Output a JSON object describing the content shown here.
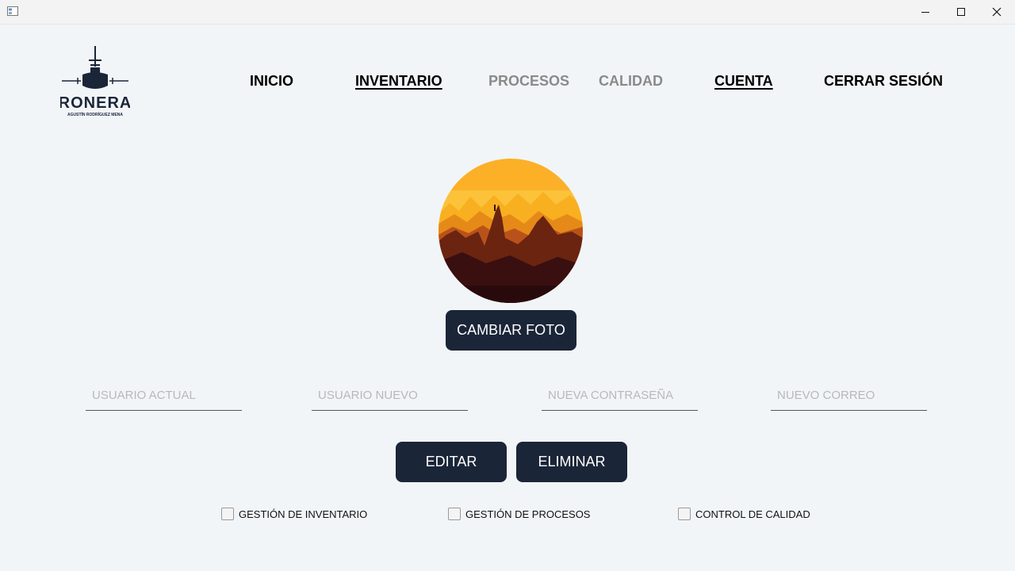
{
  "window": {
    "minimize_icon": "minimize-icon",
    "maximize_icon": "maximize-icon",
    "close_icon": "close-icon"
  },
  "logo": {
    "name": "RONERA",
    "tagline": "AGUSTÍN RODRÍGUEZ MENA"
  },
  "nav": {
    "inicio": "INICIO",
    "inventario": "INVENTARIO",
    "procesos": "PROCESOS",
    "calidad": "CALIDAD",
    "cuenta": "CUENTA",
    "cerrar_sesion": "CERRAR SESIÓN"
  },
  "profile": {
    "change_photo": "CAMBIAR FOTO"
  },
  "form": {
    "usuario_actual": {
      "placeholder": "USUARIO ACTUAL",
      "value": ""
    },
    "usuario_nuevo": {
      "placeholder": "USUARIO NUEVO",
      "value": ""
    },
    "nueva_contrasena": {
      "placeholder": "NUEVA CONTRASEÑA",
      "value": ""
    },
    "nuevo_correo": {
      "placeholder": "NUEVO CORREO",
      "value": ""
    }
  },
  "actions": {
    "editar": "EDITAR",
    "eliminar": "ELIMINAR"
  },
  "permissions": [
    {
      "label": "GESTIÓN DE INVENTARIO",
      "checked": false
    },
    {
      "label": "GESTIÓN DE PROCESOS",
      "checked": false
    },
    {
      "label": "CONTROL DE CALIDAD",
      "checked": false
    }
  ],
  "colors": {
    "accent": "#1b2538",
    "background": "#f1f5f8",
    "muted_nav": "#8a8a8a"
  }
}
